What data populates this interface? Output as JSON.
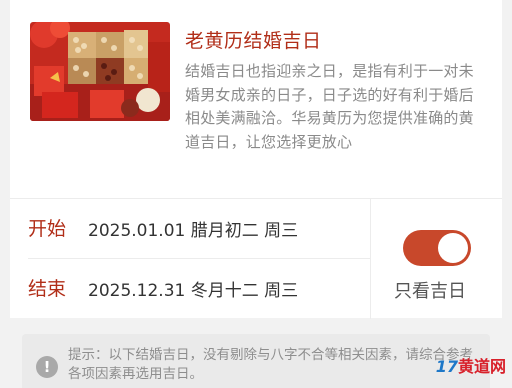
{
  "header": {
    "image_icon": "wedding-gifts-photo",
    "title": "老黄历结婚吉日",
    "description": "结婚吉日也指迎亲之日，是指有利于一对未婚男女成亲的日子，日子选的好有利于婚后相处美满融洽。华易黄历为您提供准确的黄道吉日，让您选择更放心"
  },
  "dates": {
    "start": {
      "label": "开始",
      "value": "2025.01.01 腊月初二 周三"
    },
    "end": {
      "label": "结束",
      "value": "2025.12.31 冬月十二 周三"
    }
  },
  "filter": {
    "toggle_label": "只看吉日",
    "toggle_on": true
  },
  "notice": {
    "icon": "exclamation-circle-icon",
    "text": "提示：以下结婚吉日，没有剔除与八字不合等相关因素，请综合参考各项因素再选用吉日。"
  },
  "watermark": {
    "num": "17",
    "text": "黄道网"
  },
  "colors": {
    "accent": "#b12e18",
    "toggle": "#c8482b",
    "background": "#f2f2f2"
  }
}
